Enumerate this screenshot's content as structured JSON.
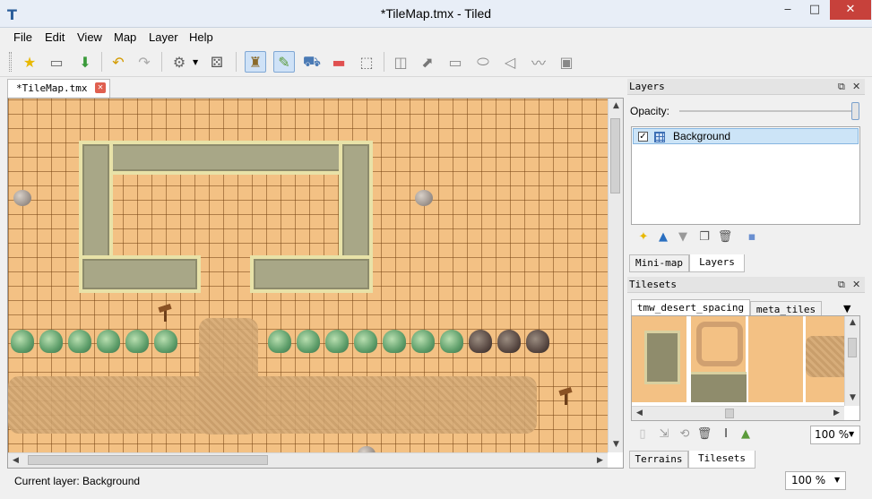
{
  "window": {
    "title": "*TileMap.tmx - Tiled",
    "app_icon": "T",
    "minimize": "‒",
    "maximize": "□",
    "close": "✕"
  },
  "menubar": {
    "items": [
      "File",
      "Edit",
      "View",
      "Map",
      "Layer",
      "Help"
    ]
  },
  "toolbar": {
    "icons": [
      "new-map-icon",
      "open-icon",
      "save-icon",
      "undo-icon",
      "redo-icon",
      "command-icon",
      "random-mode-icon",
      "stamp-brush-icon",
      "terrain-brush-icon",
      "bucket-fill-icon",
      "eraser-icon",
      "rectangular-select-icon",
      "select-objects-icon",
      "edit-polygons-icon",
      "insert-rectangle-icon",
      "insert-ellipse-icon",
      "insert-polygon-icon",
      "insert-polyline-icon",
      "insert-tile-icon"
    ]
  },
  "document_tab": {
    "label": "*TileMap.tmx",
    "close": "✕"
  },
  "statusbar": {
    "text": "Current layer: Background",
    "zoom": "100 %"
  },
  "layers_panel": {
    "title": "Layers",
    "opacity_label": "Opacity:",
    "opacity": 1.0,
    "layers": [
      {
        "name": "Background",
        "visible": true,
        "check": "✓"
      }
    ],
    "tabs": [
      "Mini-map",
      "Layers"
    ],
    "active_tab": "Layers"
  },
  "tilesets_panel": {
    "title": "Tilesets",
    "tabs": [
      "tmw_desert_spacing",
      "meta_tiles"
    ],
    "zoom": "100 %",
    "bottom_tabs": [
      "Terrains",
      "Tilesets"
    ],
    "active_bottom_tab": "Tilesets"
  },
  "colors": {
    "sand": "#f3c184",
    "wall": "#a8a787",
    "selection": "#cce4f7",
    "close_button": "#c7413b"
  }
}
